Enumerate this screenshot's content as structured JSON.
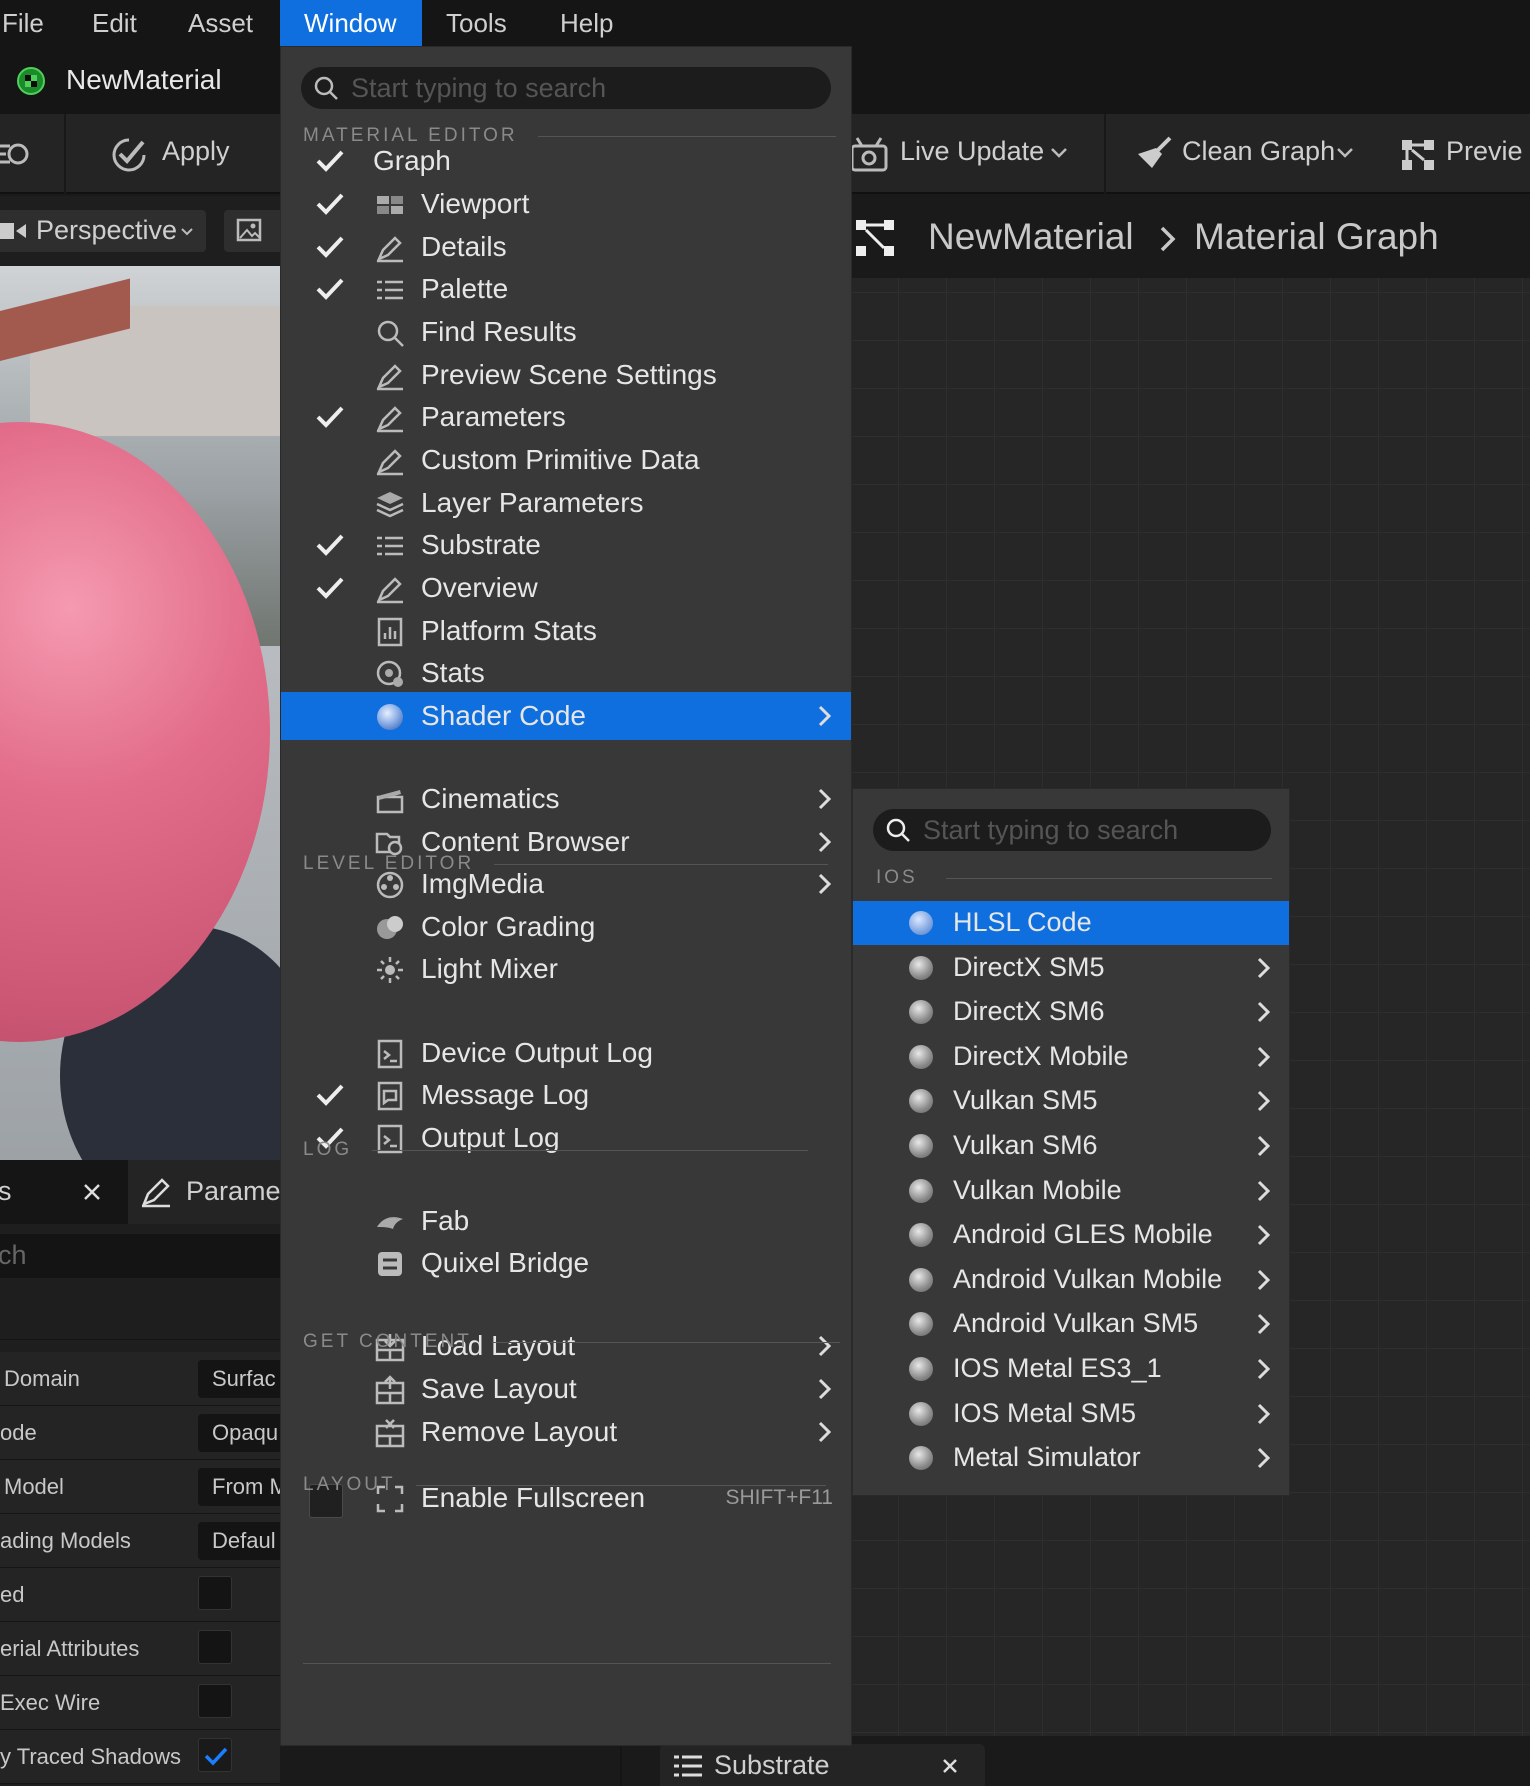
{
  "menubar": {
    "file": "File",
    "edit": "Edit",
    "asset": "Asset",
    "window": "Window",
    "tools": "Tools",
    "help": "Help"
  },
  "asset_tab": {
    "title": "NewMaterial"
  },
  "toolbar": {
    "apply": "Apply",
    "live_update": "Live Update",
    "clean_graph": "Clean Graph",
    "preview": "Previe"
  },
  "viewport": {
    "perspective": "Perspective"
  },
  "graph": {
    "breadcrumb_root": "NewMaterial",
    "breadcrumb_leaf": "Material Graph"
  },
  "details_panel": {
    "tab_prefix": "s",
    "params_tab": "Parame",
    "search_text": "ch",
    "rows": [
      {
        "label": "Domain",
        "value": "Surfac"
      },
      {
        "label": "ode",
        "value": "Opaqu"
      },
      {
        "label": "Model",
        "value": "From M"
      },
      {
        "label": "ading Models",
        "value": "Defaul"
      },
      {
        "label": "ed",
        "value": ""
      },
      {
        "label": "erial Attributes",
        "value": ""
      },
      {
        "label": "Exec Wire",
        "value": ""
      },
      {
        "label": "y Traced Shadows",
        "value": ""
      }
    ]
  },
  "bottom_tab": {
    "label": "Substrate"
  },
  "window_menu": {
    "search_placeholder": "Start typing to search",
    "sections": {
      "material_editor": "MATERIAL EDITOR",
      "level_editor": "LEVEL EDITOR",
      "log": "LOG",
      "get_content": "GET CONTENT",
      "layout": "LAYOUT"
    },
    "items": [
      {
        "label": "Graph",
        "checked": true,
        "icon": "none"
      },
      {
        "label": "Viewport",
        "checked": true,
        "icon": "viewport-icon"
      },
      {
        "label": "Details",
        "checked": true,
        "icon": "details-icon"
      },
      {
        "label": "Palette",
        "checked": true,
        "icon": "list-icon"
      },
      {
        "label": "Find Results",
        "checked": false,
        "icon": "search-icon"
      },
      {
        "label": "Preview Scene Settings",
        "checked": false,
        "icon": "details-icon"
      },
      {
        "label": "Parameters",
        "checked": true,
        "icon": "details-icon"
      },
      {
        "label": "Custom Primitive Data",
        "checked": false,
        "icon": "details-icon"
      },
      {
        "label": "Layer Parameters",
        "checked": false,
        "icon": "layers-icon"
      },
      {
        "label": "Substrate",
        "checked": true,
        "icon": "list-icon"
      },
      {
        "label": "Overview",
        "checked": true,
        "icon": "details-icon"
      },
      {
        "label": "Platform Stats",
        "checked": false,
        "icon": "stats-icon"
      },
      {
        "label": "Stats",
        "checked": false,
        "icon": "stats-gear-icon"
      },
      {
        "label": "Shader Code",
        "checked": false,
        "icon": "sphere-icon",
        "submenu": true
      },
      {
        "label": "Cinematics",
        "submenu": true,
        "icon": "clapper-icon"
      },
      {
        "label": "Content Browser",
        "submenu": true,
        "icon": "content-browser-icon"
      },
      {
        "label": "ImgMedia",
        "submenu": true,
        "icon": "film-reel-icon"
      },
      {
        "label": "Color Grading",
        "icon": "color-grading-icon"
      },
      {
        "label": "Light Mixer",
        "icon": "light-icon"
      },
      {
        "label": "Device Output Log",
        "checked": false,
        "icon": "log-icon"
      },
      {
        "label": "Message Log",
        "checked": true,
        "icon": "message-log-icon"
      },
      {
        "label": "Output Log",
        "checked": true,
        "icon": "log-icon"
      },
      {
        "label": "Fab",
        "icon": "fab-icon"
      },
      {
        "label": "Quixel Bridge",
        "icon": "bridge-icon"
      },
      {
        "label": "Load Layout",
        "submenu": true,
        "icon": "layout-load-icon"
      },
      {
        "label": "Save Layout",
        "submenu": true,
        "icon": "layout-save-icon"
      },
      {
        "label": "Remove Layout",
        "submenu": true,
        "icon": "layout-remove-icon"
      },
      {
        "label": "Enable Fullscreen",
        "shortcut": "SHIFT+F11",
        "icon": "fullscreen-icon"
      }
    ]
  },
  "shader_submenu": {
    "search_placeholder": "Start typing to search",
    "section": "IOS",
    "items": [
      {
        "label": "HLSL Code",
        "submenu": false
      },
      {
        "label": "DirectX SM5",
        "submenu": true
      },
      {
        "label": "DirectX SM6",
        "submenu": true
      },
      {
        "label": "DirectX  Mobile",
        "submenu": true
      },
      {
        "label": "Vulkan SM5",
        "submenu": true
      },
      {
        "label": "Vulkan SM6",
        "submenu": true
      },
      {
        "label": "Vulkan Mobile",
        "submenu": true
      },
      {
        "label": "Android GLES Mobile",
        "submenu": true
      },
      {
        "label": "Android Vulkan Mobile",
        "submenu": true
      },
      {
        "label": "Android Vulkan SM5",
        "submenu": true
      },
      {
        "label": "IOS Metal ES3_1",
        "submenu": true
      },
      {
        "label": "IOS Metal SM5",
        "submenu": true
      },
      {
        "label": "Metal Simulator",
        "submenu": true
      }
    ]
  },
  "colors": {
    "accent": "#0f6fde",
    "menu_bg": "#383838",
    "sphere": "#e0607c"
  }
}
